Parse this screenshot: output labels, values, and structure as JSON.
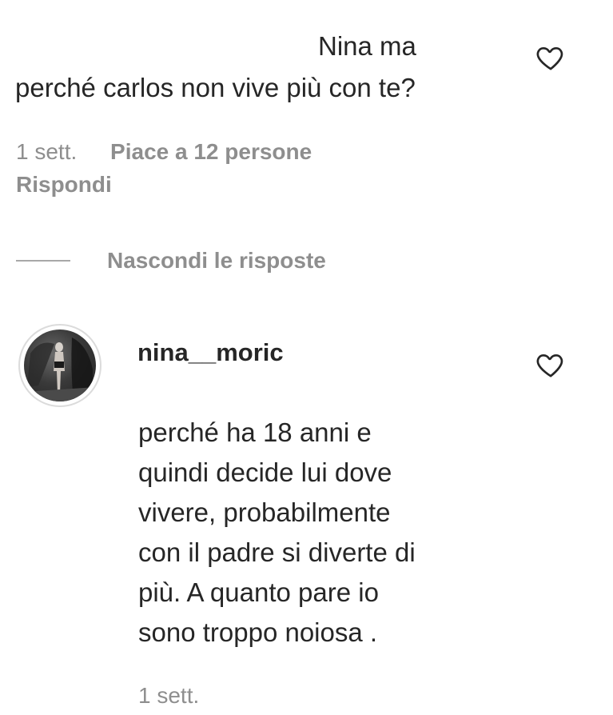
{
  "comment1": {
    "text_line1": "Nina ma",
    "text_line2": "perché carlos non vive più con te?",
    "time": "1 sett.",
    "likes": "Piace a 12 persone",
    "reply": "Rispondi",
    "heart_icon": "heart-outline-icon"
  },
  "replies_toggle": {
    "label": "Nascondi le risposte"
  },
  "comment2": {
    "username": "nina__moric",
    "lines": [
      "perché ha 18 anni e",
      "quindi decide lui dove",
      "vivere, probabilmente",
      "con il padre si diverte di",
      "più. A quanto pare io",
      "sono troppo noiosa ."
    ],
    "time": "1 sett.",
    "heart_icon": "heart-outline-icon"
  },
  "colors": {
    "text": "#262626",
    "secondary": "#8e8e8e",
    "background": "#ffffff"
  }
}
